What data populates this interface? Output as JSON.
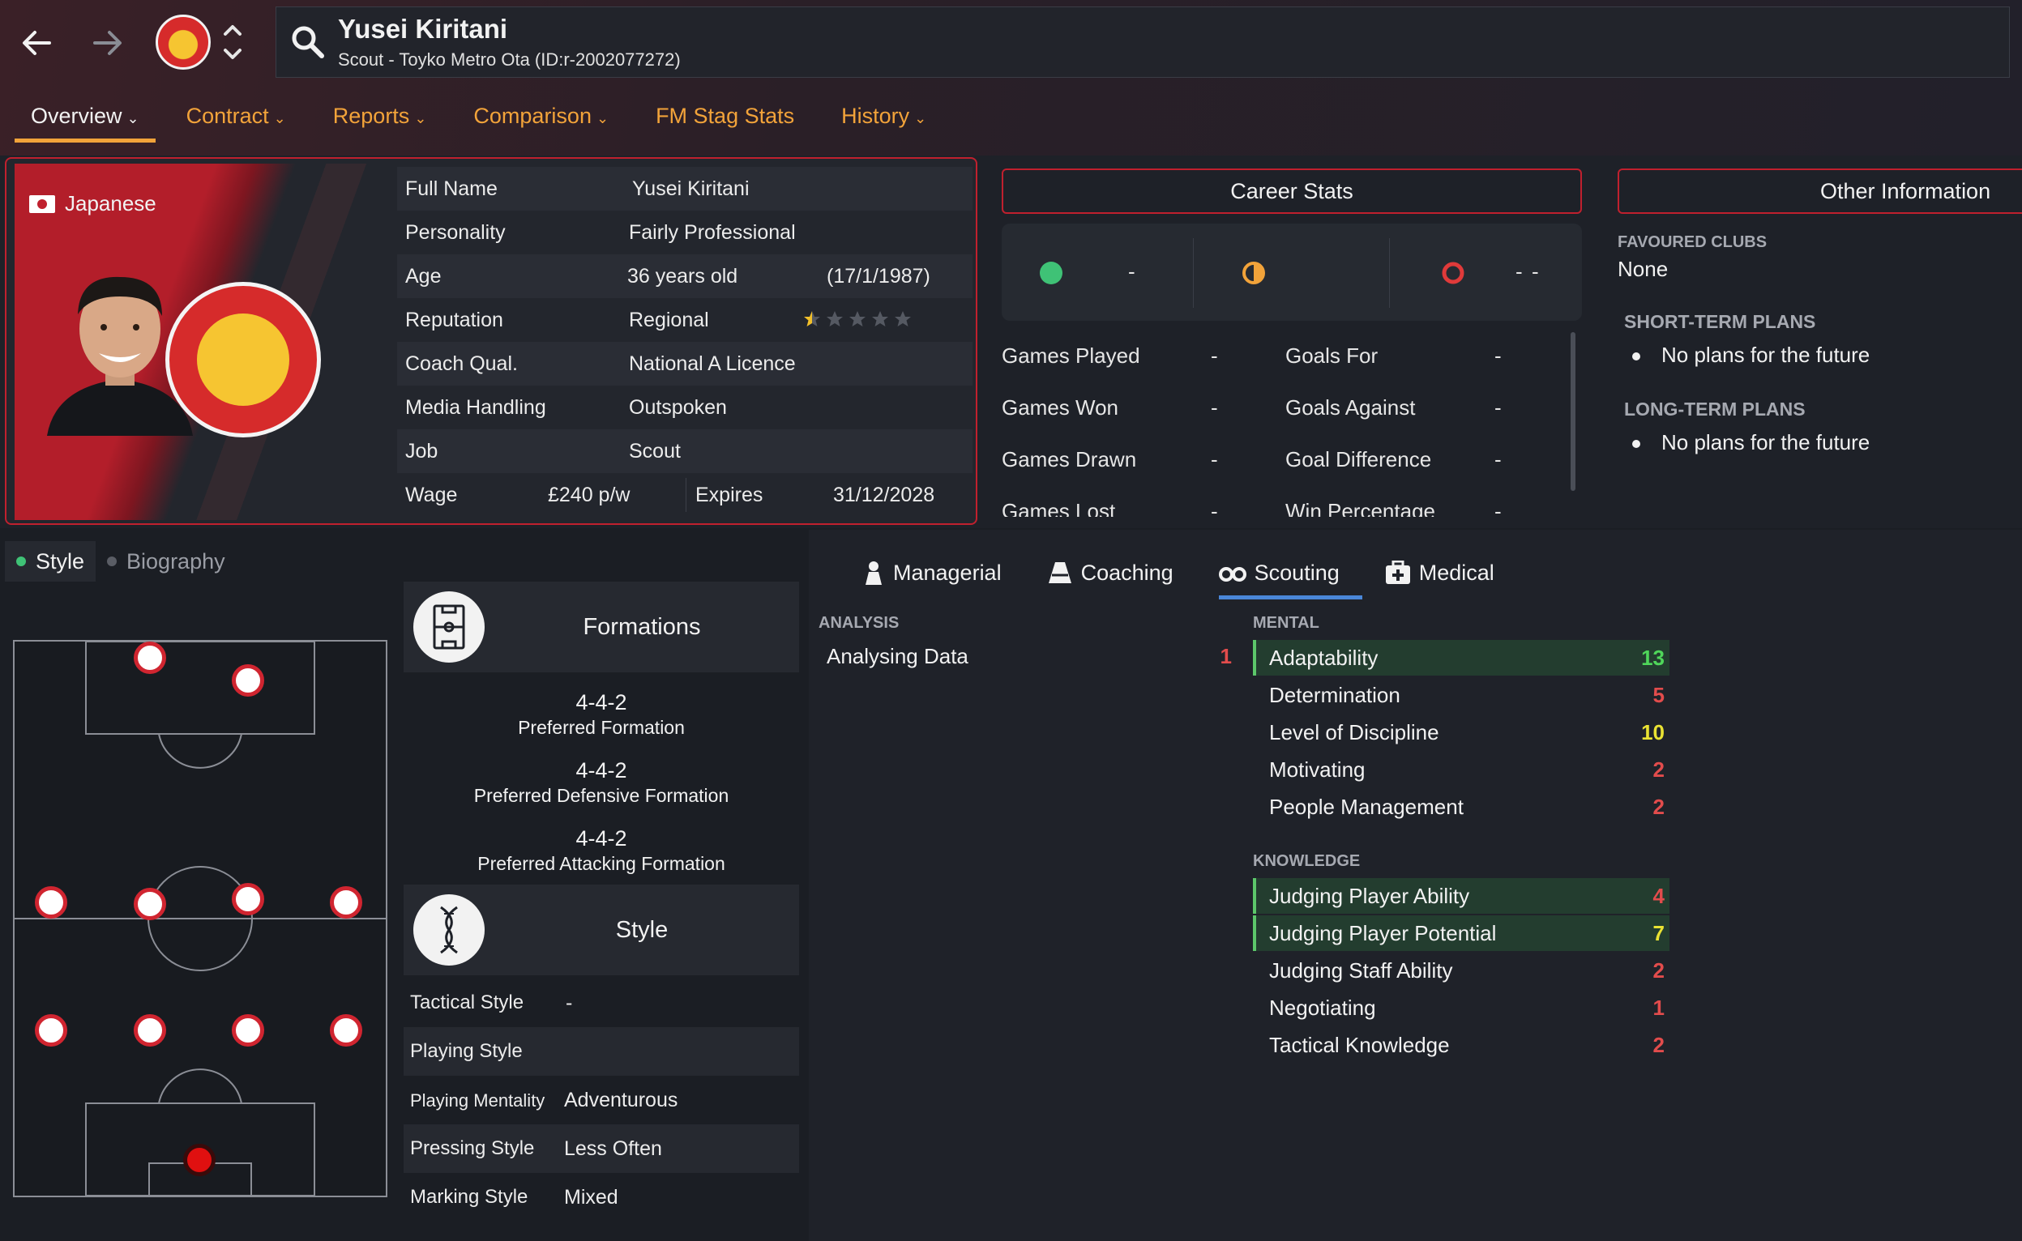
{
  "header": {
    "name": "Yusei Kiritani",
    "subtitle": "Scout - Toyko Metro Ota (ID:r-2002077272)"
  },
  "tabs": [
    {
      "label": "Overview",
      "chevron": "⌄"
    },
    {
      "label": "Contract",
      "chevron": "⌄"
    },
    {
      "label": "Reports",
      "chevron": "⌄"
    },
    {
      "label": "Comparison",
      "chevron": "⌄"
    },
    {
      "label": "FM Stag Stats",
      "chevron": ""
    },
    {
      "label": "History",
      "chevron": "⌄"
    }
  ],
  "profile": {
    "nationality": "Japanese",
    "rows": [
      {
        "key": "Full Name",
        "value": "Yusei Kiritani"
      },
      {
        "key": "Personality",
        "value": "Fairly Professional"
      },
      {
        "key": "Age",
        "value": "36 years old",
        "extra": "(17/1/1987)"
      },
      {
        "key": "Reputation",
        "value": "Regional"
      },
      {
        "key": "Coach Qual.",
        "value": "National A Licence"
      },
      {
        "key": "Media Handling",
        "value": "Outspoken"
      },
      {
        "key": "Job",
        "value": "Scout"
      }
    ],
    "wage_key": "Wage",
    "wage_value": "£240 p/w",
    "expires_key": "Expires",
    "expires_value": "31/12/2028",
    "reputation_stars": 0.5
  },
  "career": {
    "title": "Career Stats",
    "wins": "-",
    "draws": "-",
    "losses": "-",
    "rows": [
      {
        "a": "Games Played",
        "b": "-",
        "c": "Goals For",
        "d": "-"
      },
      {
        "a": "Games Won",
        "b": "-",
        "c": "Goals Against",
        "d": "-"
      },
      {
        "a": "Games Drawn",
        "b": "-",
        "c": "Goal Difference",
        "d": "-"
      },
      {
        "a": "Games Lost",
        "b": "-",
        "c": "Win Percentage",
        "d": "-"
      }
    ]
  },
  "other": {
    "title": "Other Information",
    "favoured_h": "FAVOURED CLUBS",
    "favoured_v": "None",
    "short_h": "SHORT-TERM PLANS",
    "short_v": "No plans for the future",
    "long_h": "LONG-TERM PLANS",
    "long_v": "No plans for the future"
  },
  "style_tabs": {
    "style": "Style",
    "bio": "Biography"
  },
  "formations": {
    "title": "Formations",
    "items": [
      {
        "name": "4-4-2",
        "label": "Preferred Formation"
      },
      {
        "name": "4-4-2",
        "label": "Preferred Defensive Formation"
      },
      {
        "name": "4-4-2",
        "label": "Preferred Attacking Formation"
      }
    ]
  },
  "style": {
    "title": "Style",
    "rows": [
      {
        "key": "Tactical Style",
        "value": "-"
      },
      {
        "key": "Playing Style",
        "value": ""
      },
      {
        "key": "Playing Mentality",
        "value": "Adventurous"
      },
      {
        "key": "Pressing Style",
        "value": "Less Often"
      },
      {
        "key": "Marking Style",
        "value": "Mixed"
      }
    ]
  },
  "attr_tabs": [
    "Managerial",
    "Coaching",
    "Scouting",
    "Medical"
  ],
  "analysis": {
    "heading": "ANALYSIS",
    "rows": [
      {
        "name": "Analysing Data",
        "value": "1"
      }
    ]
  },
  "mental": {
    "heading": "MENTAL",
    "rows": [
      {
        "name": "Adaptability",
        "value": "13"
      },
      {
        "name": "Determination",
        "value": "5"
      },
      {
        "name": "Level of Discipline",
        "value": "10"
      },
      {
        "name": "Motivating",
        "value": "2"
      },
      {
        "name": "People Management",
        "value": "2"
      }
    ]
  },
  "knowledge": {
    "heading": "KNOWLEDGE",
    "rows": [
      {
        "name": "Judging Player Ability",
        "value": "4"
      },
      {
        "name": "Judging Player Potential",
        "value": "7"
      },
      {
        "name": "Judging Staff Ability",
        "value": "2"
      },
      {
        "name": "Negotiating",
        "value": "1"
      },
      {
        "name": "Tactical Knowledge",
        "value": "2"
      }
    ]
  },
  "colors": {
    "accent": "#f2a33a",
    "brand_red": "#c0202e",
    "attr_red": "#e24c4c",
    "attr_yellow": "#e9e233",
    "attr_green": "#4fd65a",
    "tab_blue": "#4a87d8"
  }
}
